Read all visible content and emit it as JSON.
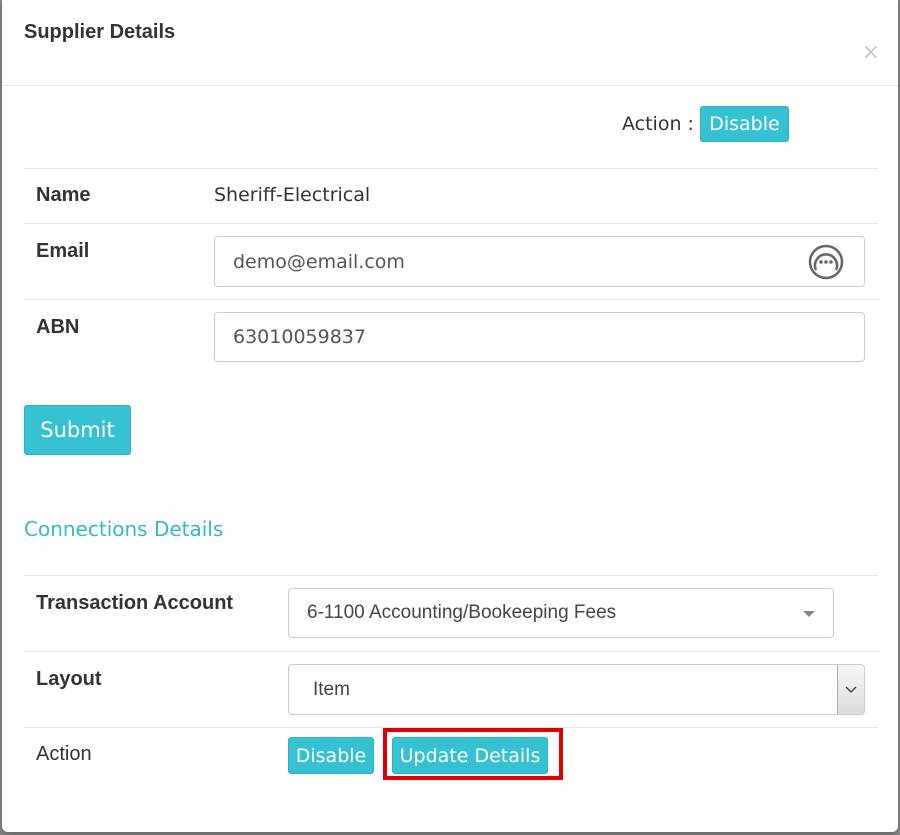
{
  "modal": {
    "title": "Supplier Details",
    "close_label": "×"
  },
  "top_action": {
    "label": "Action :",
    "button": "Disable"
  },
  "fields": {
    "name_label": "Name",
    "name_value": "Sheriff-Electrical",
    "email_label": "Email",
    "email_value": "demo@email.com",
    "abn_label": "ABN",
    "abn_value": "63010059837"
  },
  "submit_label": "Submit",
  "connections": {
    "title": "Connections Details",
    "transaction_account_label": "Transaction Account",
    "transaction_account_value": "6-1100 Accounting/Bookeeping Fees",
    "layout_label": "Layout",
    "layout_value": "Item",
    "action_label": "Action",
    "disable_button": "Disable",
    "update_button": "Update Details"
  },
  "colors": {
    "accent": "#36c1d3",
    "section_title": "#36b9c8",
    "highlight": "#e00000"
  }
}
